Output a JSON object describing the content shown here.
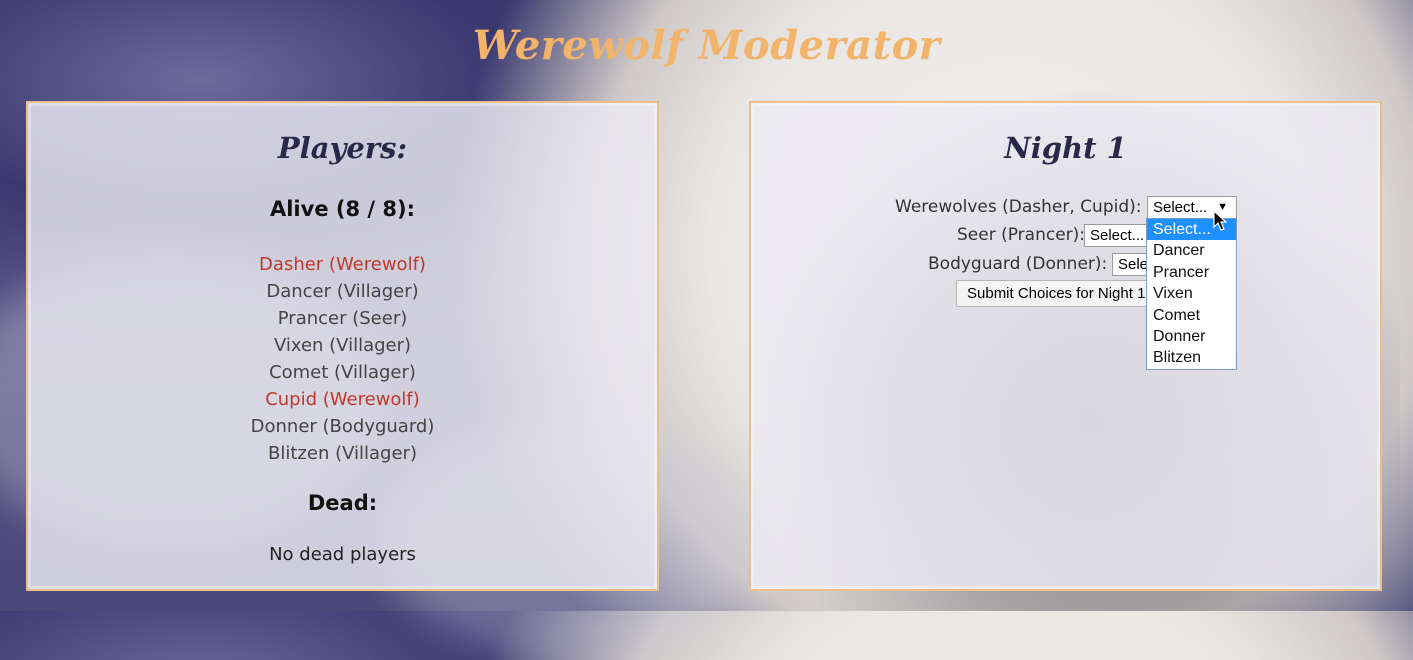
{
  "app": {
    "title": "Werewolf Moderator"
  },
  "players_panel": {
    "heading": "Players:",
    "alive_heading": "Alive (8 / 8):",
    "alive": [
      {
        "label": "Dasher (Werewolf)",
        "werewolf": true
      },
      {
        "label": "Dancer (Villager)",
        "werewolf": false
      },
      {
        "label": "Prancer (Seer)",
        "werewolf": false
      },
      {
        "label": "Vixen (Villager)",
        "werewolf": false
      },
      {
        "label": "Comet (Villager)",
        "werewolf": false
      },
      {
        "label": "Cupid (Werewolf)",
        "werewolf": true
      },
      {
        "label": "Donner (Bodyguard)",
        "werewolf": false
      },
      {
        "label": "Blitzen (Villager)",
        "werewolf": false
      }
    ],
    "dead_heading": "Dead:",
    "dead_text": "No dead players"
  },
  "night_panel": {
    "heading": "Night 1",
    "werewolves_label": "Werewolves (Dasher, Cupid):",
    "werewolves_value": "Select...",
    "seer_label": "Seer (Prancer):",
    "seer_value": "Select...",
    "bodyguard_label": "Bodyguard (Donner):",
    "bodyguard_value": "Select...",
    "submit_label": "Submit Choices for Night 1"
  },
  "dropdown": {
    "options": [
      "Select...",
      "Dancer",
      "Prancer",
      "Vixen",
      "Comet",
      "Donner",
      "Blitzen"
    ],
    "selected_index": 0
  },
  "colors": {
    "accent": "#f2b36a",
    "werewolf": "#c0392b",
    "highlight": "#1e90ff"
  }
}
